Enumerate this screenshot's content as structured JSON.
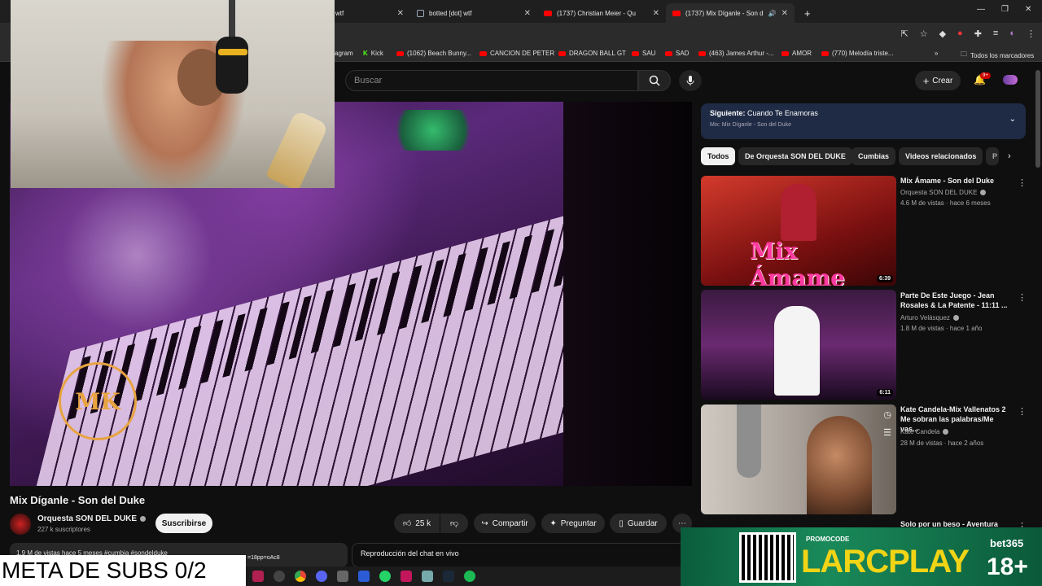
{
  "browser": {
    "tabs": [
      {
        "label": "wtf",
        "favicon": "none"
      },
      {
        "label": "botted [dot] wtf",
        "favicon": "bot-icon"
      },
      {
        "label": "(1737) Christian Meier - Qu",
        "favicon": "youtube-icon"
      },
      {
        "label": "(1737) Mix Díganle - Son d",
        "favicon": "youtube-icon"
      }
    ],
    "new_tab": "+",
    "bookmarks": [
      "agram",
      "Kick",
      "(1062) Beach Bunny...",
      "CANCION DE PETER",
      "DRAGON BALL GT",
      "SAU",
      "SAD",
      "(463) James Arthur -...",
      "AMOR",
      "(770) Melodía triste..."
    ],
    "bookmarks_more": "»",
    "all_bookmarks": "Todos los marcadores"
  },
  "header": {
    "search_placeholder": "Buscar",
    "create_label": "Crear",
    "notif_count": "9+"
  },
  "video": {
    "title": "Mix Díganle - Son del Duke",
    "logo_text": "MK"
  },
  "channel": {
    "name": "Orquesta SON DEL DUKE",
    "subscribers": "227 k suscriptores",
    "subscribe_label": "Suscribirse"
  },
  "actions": {
    "likes": "25 k",
    "share": "Compartir",
    "ask": "Preguntar",
    "save": "Guardar"
  },
  "description": {
    "text": "1,9 M de vistas hace 5 meses #cumbia #sondelduke"
  },
  "chat": {
    "label": "Reproducción del chat en vivo"
  },
  "up_next": {
    "label": "Siguiente:",
    "title": "Cuando Te Enamoras",
    "subtitle": "Mix: Mix Díganle - Son del Duke"
  },
  "chips": [
    "Todos",
    "De Orquesta SON DEL DUKE",
    "Cumbias",
    "Videos relacionados",
    "P"
  ],
  "recommendations": [
    {
      "title": "Mix Ámame - Son del Duke",
      "channel": "Orquesta SON DEL DUKE",
      "meta": "4.6 M de vistas · hace 6 meses",
      "duration": "6:39",
      "thumb_text": "Mix Ámame"
    },
    {
      "title": "Parte De Este Juego - Jean Rosales & La Patente - 11:11 ...",
      "channel": "Arturo Velásquez",
      "meta": "1.8 M de vistas · hace 1 año",
      "duration": "6:11"
    },
    {
      "title": "Kate Candela-Mix Vallenatos 2 Me sobran las palabras/Me vas...",
      "channel": "Kate Candela",
      "meta": "28 M de vistas · hace 2 años"
    },
    {
      "title": "Solo por un beso - Aventura"
    }
  ],
  "overlay": {
    "subs_goal": "META DE SUBS 0/2",
    "url_fragment": "=18pp=oAc8",
    "promo_label": "PROMOCODE",
    "promo_code": "LARCPLAY",
    "promo_brand": "bet365",
    "promo_age": "18+"
  },
  "colors": {
    "background": "#0f0f0f",
    "accent_red": "#ff0000",
    "next_card": "#1f2a44",
    "promo_yellow": "#f2d416"
  }
}
